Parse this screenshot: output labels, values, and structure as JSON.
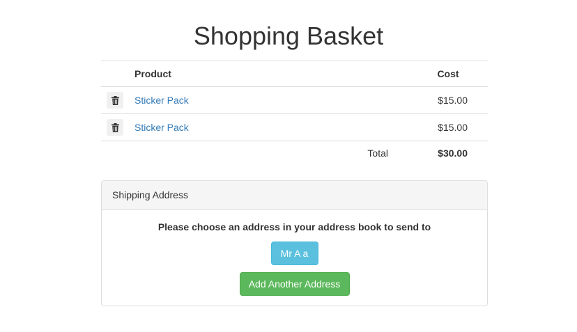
{
  "page": {
    "title": "Shopping Basket"
  },
  "basket": {
    "headers": {
      "product": "Product",
      "cost": "Cost"
    },
    "items": [
      {
        "name": "Sticker Pack",
        "cost": "$15.00",
        "icon": "trash-icon"
      },
      {
        "name": "Sticker Pack",
        "cost": "$15.00",
        "icon": "trash-icon"
      }
    ],
    "total_label": "Total",
    "total_value": "$30.00"
  },
  "shipping": {
    "heading": "Shipping Address",
    "prompt": "Please choose an address in your address book to send to",
    "address_button": "Mr A a",
    "add_button": "Add Another Address"
  },
  "colors": {
    "link": "#337ab7",
    "info_button": "#5bc0de",
    "success_button": "#5cb85c",
    "panel_heading_bg": "#f5f5f5",
    "border": "#dddddd"
  }
}
